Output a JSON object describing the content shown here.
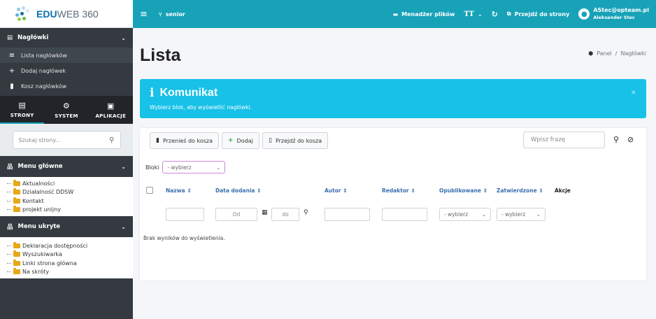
{
  "brand": {
    "bold": "EDU",
    "rest": "WEB 360"
  },
  "sidebar": {
    "section": {
      "label": "Nagłówki",
      "icon": "newspaper-icon"
    },
    "links": [
      {
        "label": "Lista nagłówków",
        "icon": "list-icon"
      },
      {
        "label": "Dodaj nagłówek",
        "icon": "plus-icon"
      },
      {
        "label": "Kosz nagłówków",
        "icon": "trash-icon"
      }
    ],
    "tabs": [
      {
        "label": "STRONY",
        "icon": "file-icon"
      },
      {
        "label": "SYSTEM",
        "icon": "cogs-icon"
      },
      {
        "label": "APLIKACJE",
        "icon": "window-icon"
      }
    ],
    "search_placeholder": "Szukaj strony...",
    "menu_glowne": {
      "title": "Menu główne",
      "items": [
        "Aktualności",
        "Działalność DDSW",
        "Kontakt",
        "projekt unijny"
      ]
    },
    "menu_ukryte": {
      "title": "Menu ukryte",
      "items": [
        "Deklaracja dostępności",
        "Wyszukiwarka",
        "Linki strona główna",
        "Na skróty"
      ]
    }
  },
  "topbar": {
    "site_name": "senior",
    "file_manager": "Menadżer plików",
    "text_size": "TT",
    "go_to_site": "Przejdź do strony",
    "user_email": "AStec@opteam.pl",
    "user_name": "Aleksander Stec"
  },
  "page": {
    "title": "Lista",
    "breadcrumb": {
      "home": "Panel",
      "separator": "/",
      "current": "Nagłówki"
    }
  },
  "callout": {
    "title": "Komunikat",
    "message": "Wybierz blok, aby wyświetlić nagłówki.",
    "color": "#17c1e8"
  },
  "toolbar": {
    "move_to_trash": "Przenieś do kosza",
    "add": "Dodaj",
    "go_to_trash": "Przejdź do kosza",
    "search_placeholder": "Wpisz frazę"
  },
  "filter": {
    "label": "Bloki",
    "value": "- wybierz"
  },
  "table": {
    "columns": [
      "Nazwa",
      "Data dodania",
      "Autor",
      "Redaktor",
      "Opublikowane",
      "Zatwierdzone",
      "Akcje"
    ],
    "date_from": "Od",
    "date_to": "do",
    "published_filter": "- wybierz",
    "approved_filter": "- wybierz",
    "empty_message": "Brak wyników do wyświetlenia."
  },
  "colors": {
    "accent": "#17a2b8",
    "sidebar": "#343a40",
    "link": "#3a6fb0"
  }
}
